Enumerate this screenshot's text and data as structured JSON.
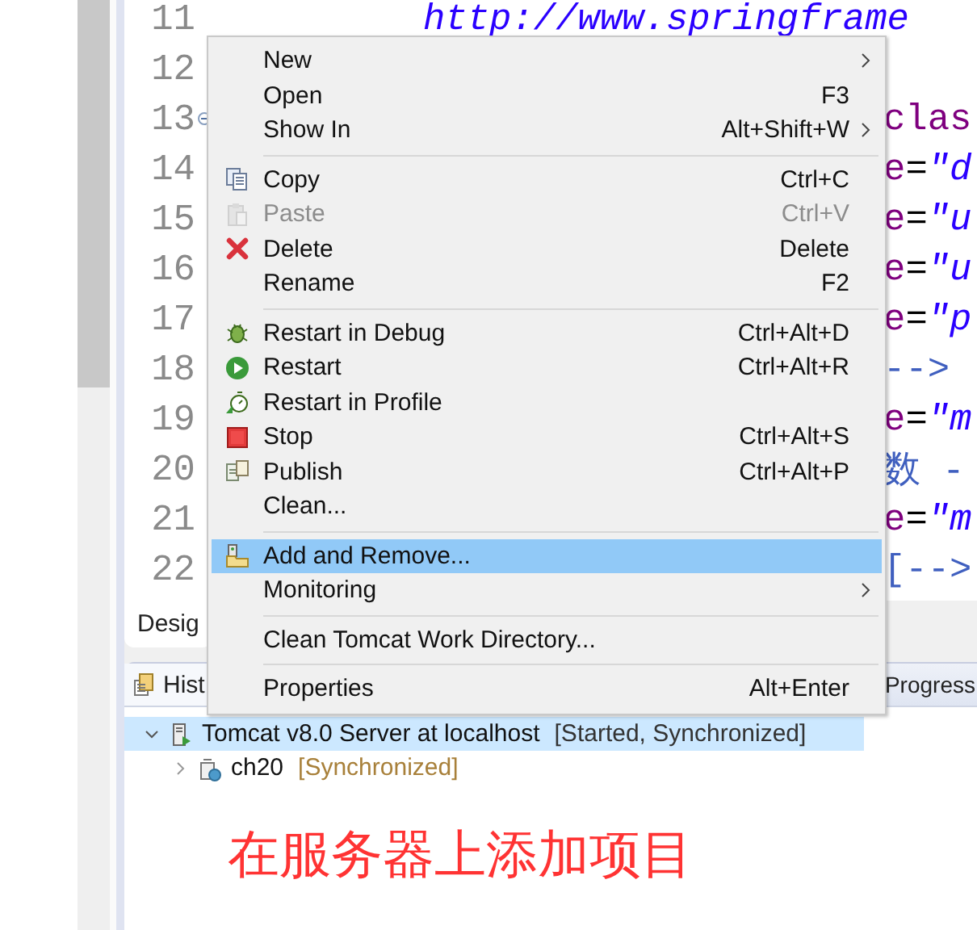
{
  "editor": {
    "lines": [
      {
        "number": "11",
        "foldable": false,
        "kind": "full",
        "segments": [
          {
            "kind": "value",
            "text": "http://www.springframe"
          }
        ]
      },
      {
        "number": "12",
        "foldable": false
      },
      {
        "number": "13",
        "foldable": true,
        "kind": "tail",
        "segments": [
          {
            "kind": "tag",
            "text": "clas"
          }
        ]
      },
      {
        "number": "14",
        "foldable": false,
        "kind": "tail",
        "segments": [
          {
            "kind": "attr",
            "text": "e"
          },
          {
            "kind": "plain",
            "text": "="
          },
          {
            "kind": "value",
            "text": "\"d"
          }
        ]
      },
      {
        "number": "15",
        "foldable": false,
        "kind": "tail",
        "segments": [
          {
            "kind": "attr",
            "text": "e"
          },
          {
            "kind": "plain",
            "text": "="
          },
          {
            "kind": "value",
            "text": "\"u"
          }
        ]
      },
      {
        "number": "16",
        "foldable": false,
        "kind": "tail",
        "segments": [
          {
            "kind": "attr",
            "text": "e"
          },
          {
            "kind": "plain",
            "text": "="
          },
          {
            "kind": "value",
            "text": "\"u"
          }
        ]
      },
      {
        "number": "17",
        "foldable": false,
        "kind": "tail",
        "segments": [
          {
            "kind": "attr",
            "text": "e"
          },
          {
            "kind": "plain",
            "text": "="
          },
          {
            "kind": "value",
            "text": "\"p"
          }
        ]
      },
      {
        "number": "18",
        "foldable": false,
        "kind": "tail",
        "segments": [
          {
            "kind": "comment",
            "text": "-->"
          }
        ]
      },
      {
        "number": "19",
        "foldable": false,
        "kind": "tail",
        "segments": [
          {
            "kind": "attr",
            "text": "e"
          },
          {
            "kind": "plain",
            "text": "="
          },
          {
            "kind": "value",
            "text": "\"m"
          }
        ]
      },
      {
        "number": "20",
        "foldable": false,
        "kind": "tail",
        "segments": [
          {
            "kind": "comment",
            "text": "数 -"
          }
        ]
      },
      {
        "number": "21",
        "foldable": false,
        "kind": "tail",
        "segments": [
          {
            "kind": "attr",
            "text": "e"
          },
          {
            "kind": "plain",
            "text": "="
          },
          {
            "kind": "value",
            "text": "\"m"
          }
        ]
      },
      {
        "number": "22",
        "foldable": false,
        "kind": "tail",
        "segments": [
          {
            "kind": "comment",
            "text": "[-->"
          }
        ]
      }
    ]
  },
  "editor_tabs": [
    {
      "label": "Desig",
      "selected": true
    }
  ],
  "view": {
    "tabs": [
      {
        "label": "Hist",
        "selected": true
      },
      {
        "label": "Progress",
        "selected": false
      }
    ],
    "tree": [
      {
        "label": "Tomcat v8.0 Server at localhost",
        "status": "[Started, Synchronized]",
        "expanded": true,
        "selected": true,
        "kind": "server",
        "children": [
          {
            "label": "ch20",
            "status": "[Synchronized]",
            "expanded": false,
            "selected": false,
            "kind": "module"
          }
        ]
      }
    ]
  },
  "annotation": "在服务器上添加项目",
  "menu": {
    "items": [
      {
        "kind": "plain",
        "label": "New",
        "submenu": true,
        "disabled": false,
        "selected": false
      },
      {
        "kind": "plain",
        "label": "Open",
        "shortcut": "F3",
        "submenu": false,
        "disabled": false,
        "selected": false
      },
      {
        "kind": "plain",
        "label": "Show In",
        "shortcut": "Alt+Shift+W",
        "submenu": true,
        "disabled": false,
        "selected": false
      },
      {
        "kind": "separator"
      },
      {
        "kind": "copy",
        "label": "Copy",
        "shortcut": "Ctrl+C",
        "submenu": false,
        "disabled": false,
        "selected": false
      },
      {
        "kind": "paste",
        "label": "Paste",
        "shortcut": "Ctrl+V",
        "submenu": false,
        "disabled": true,
        "selected": false
      },
      {
        "kind": "delete",
        "label": "Delete",
        "shortcut": "Delete",
        "submenu": false,
        "disabled": false,
        "selected": false
      },
      {
        "kind": "plain",
        "label": "Rename",
        "shortcut": "F2",
        "submenu": false,
        "disabled": false,
        "selected": false
      },
      {
        "kind": "separator"
      },
      {
        "kind": "debug",
        "label": "Restart in Debug",
        "shortcut": "Ctrl+Alt+D",
        "submenu": false,
        "disabled": false,
        "selected": false
      },
      {
        "kind": "restart",
        "label": "Restart",
        "shortcut": "Ctrl+Alt+R",
        "submenu": false,
        "disabled": false,
        "selected": false
      },
      {
        "kind": "profile",
        "label": "Restart in Profile",
        "submenu": false,
        "disabled": false,
        "selected": false
      },
      {
        "kind": "stop",
        "label": "Stop",
        "shortcut": "Ctrl+Alt+S",
        "submenu": false,
        "disabled": false,
        "selected": false
      },
      {
        "kind": "publish",
        "label": "Publish",
        "shortcut": "Ctrl+Alt+P",
        "submenu": false,
        "disabled": false,
        "selected": false
      },
      {
        "kind": "plain",
        "label": "Clean...",
        "submenu": false,
        "disabled": false,
        "selected": false
      },
      {
        "kind": "separator"
      },
      {
        "kind": "addremove",
        "label": "Add and Remove...",
        "submenu": false,
        "disabled": false,
        "selected": true
      },
      {
        "kind": "plain",
        "label": "Monitoring",
        "submenu": true,
        "disabled": false,
        "selected": false
      },
      {
        "kind": "separator"
      },
      {
        "kind": "plain",
        "label": "Clean Tomcat Work Directory...",
        "submenu": false,
        "disabled": false,
        "selected": false
      },
      {
        "kind": "separator"
      },
      {
        "kind": "plain",
        "label": "Properties",
        "shortcut": "Alt+Enter",
        "submenu": false,
        "disabled": false,
        "selected": false
      }
    ]
  }
}
